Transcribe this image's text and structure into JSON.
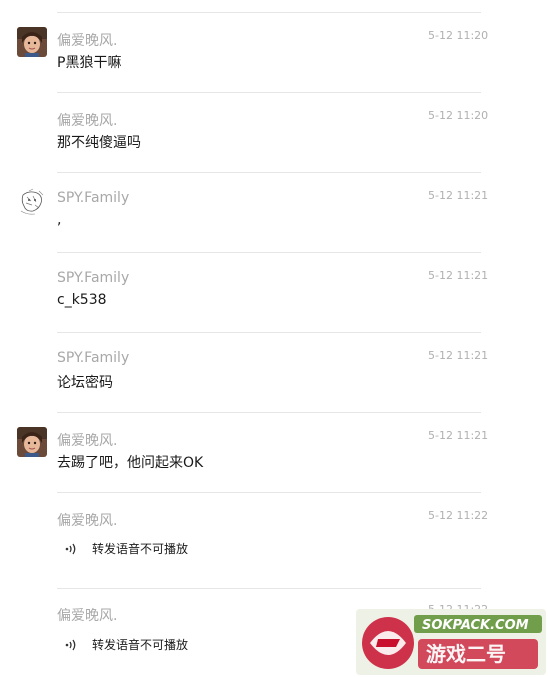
{
  "messages": [
    {
      "sender": "偏爱晚风.",
      "time": "5-12 11:20",
      "text": "P黑狼干嘛",
      "avatar": "girl-avatar"
    },
    {
      "sender": "偏爱晚风.",
      "time": "5-12 11:20",
      "text": "那不纯傻逼吗"
    },
    {
      "sender": "SPY.Family",
      "time": "5-12 11:21",
      "text": ",",
      "avatar": "sketch-avatar"
    },
    {
      "sender": "SPY.Family",
      "time": "5-12 11:21",
      "text": "c_k538"
    },
    {
      "sender": "SPY.Family",
      "time": "5-12 11:21",
      "text": "论坛密码"
    },
    {
      "sender": "偏爱晚风.",
      "time": "5-12 11:21",
      "text": "去踢了吧，他问起来OK",
      "avatar": "girl-avatar"
    },
    {
      "sender": "偏爱晚风.",
      "time": "5-12 11:22",
      "voice_label": "转发语音不可播放"
    },
    {
      "sender": "偏爱晚风.",
      "time": "5-12 11:22",
      "voice_label": "转发语音不可播放"
    }
  ],
  "watermark": {
    "text": "SOKPACK.COM",
    "colors": {
      "red": "#c8102e",
      "green": "#5a8f2e"
    }
  }
}
